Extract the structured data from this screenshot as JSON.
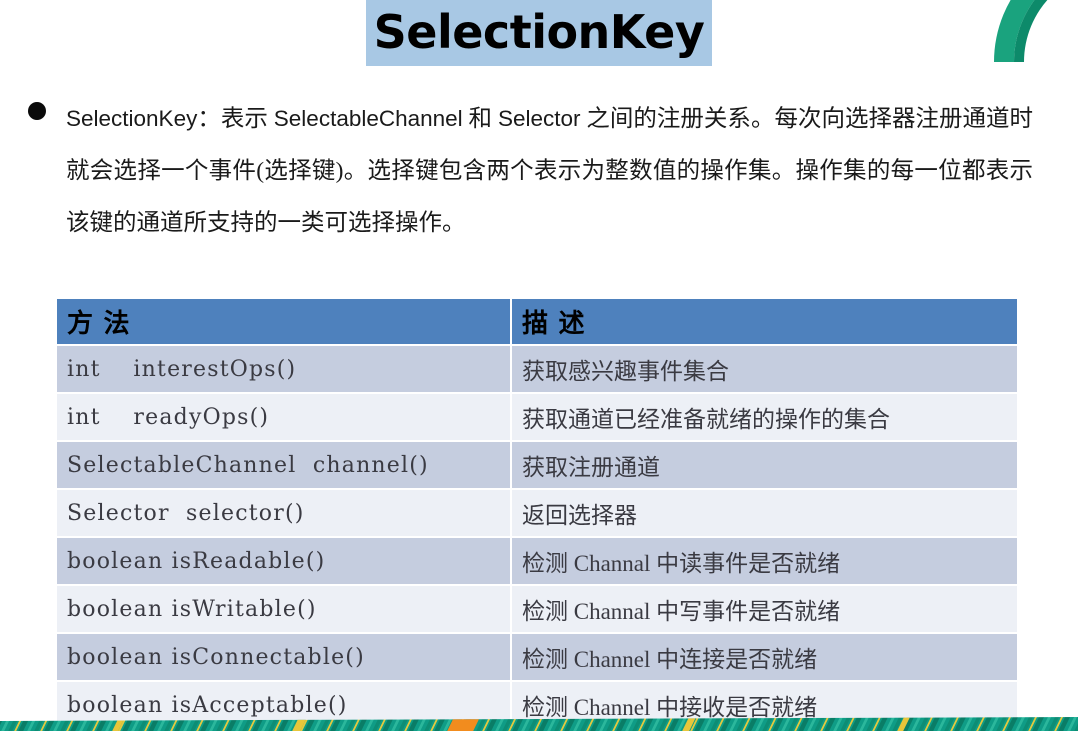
{
  "slide": {
    "title": "SelectionKey",
    "title_highlight_color": "#a8c8e4",
    "background_color": "#ffffff",
    "accent_color": "#4e81bd",
    "decoration_teal": "#1aa37e",
    "decoration_green": "#0d8a6a",
    "decoration_orange": "#f28c1e",
    "decoration_yellow": "#e8c63a"
  },
  "bullet": {
    "segments": [
      {
        "type": "lat",
        "text": "SelectionKey"
      },
      {
        "type": "cjk",
        "text": "："
      },
      {
        "type": "cjk",
        "text": "表示 "
      },
      {
        "type": "lat",
        "text": "SelectableChannel"
      },
      {
        "type": "cjk",
        "text": " 和 "
      },
      {
        "type": "lat",
        "text": "Selector"
      },
      {
        "type": "cjk",
        "text": " 之间的注册关系。每次向选择器注册通道时就会选择一个事件(选择键)。选择键包含两个表示为整数值的操作集。操作集的每一位都表示该键的通道所支持的一类可选择操作。"
      }
    ],
    "plain_text": "SelectionKey：表示 SelectableChannel 和 Selector 之间的注册关系。每次向选择器注册通道时就会选择一个事件(选择键)。选择键包含两个表示为整数值的操作集。操作集的每一位都表示该键的通道所支持的一类可选择操作。"
  },
  "table": {
    "headers": [
      "方  法",
      "描  述"
    ],
    "rows": [
      {
        "method": "int    interestOps()",
        "desc": "获取感兴趣事件集合"
      },
      {
        "method": "int    readyOps()",
        "desc": "获取通道已经准备就绪的操作的集合"
      },
      {
        "method": "SelectableChannel  channel()",
        "desc": "获取注册通道"
      },
      {
        "method": "Selector  selector()",
        "desc": "返回选择器"
      },
      {
        "method": "boolean isReadable()",
        "desc": "检测 Channal 中读事件是否就绪"
      },
      {
        "method": "boolean isWritable()",
        "desc": "检测 Channal 中写事件是否就绪"
      },
      {
        "method": "boolean isConnectable()",
        "desc": "检测 Channel 中连接是否就绪"
      },
      {
        "method": "boolean isAcceptable()",
        "desc": "检测 Channel 中接收是否就绪"
      }
    ]
  }
}
